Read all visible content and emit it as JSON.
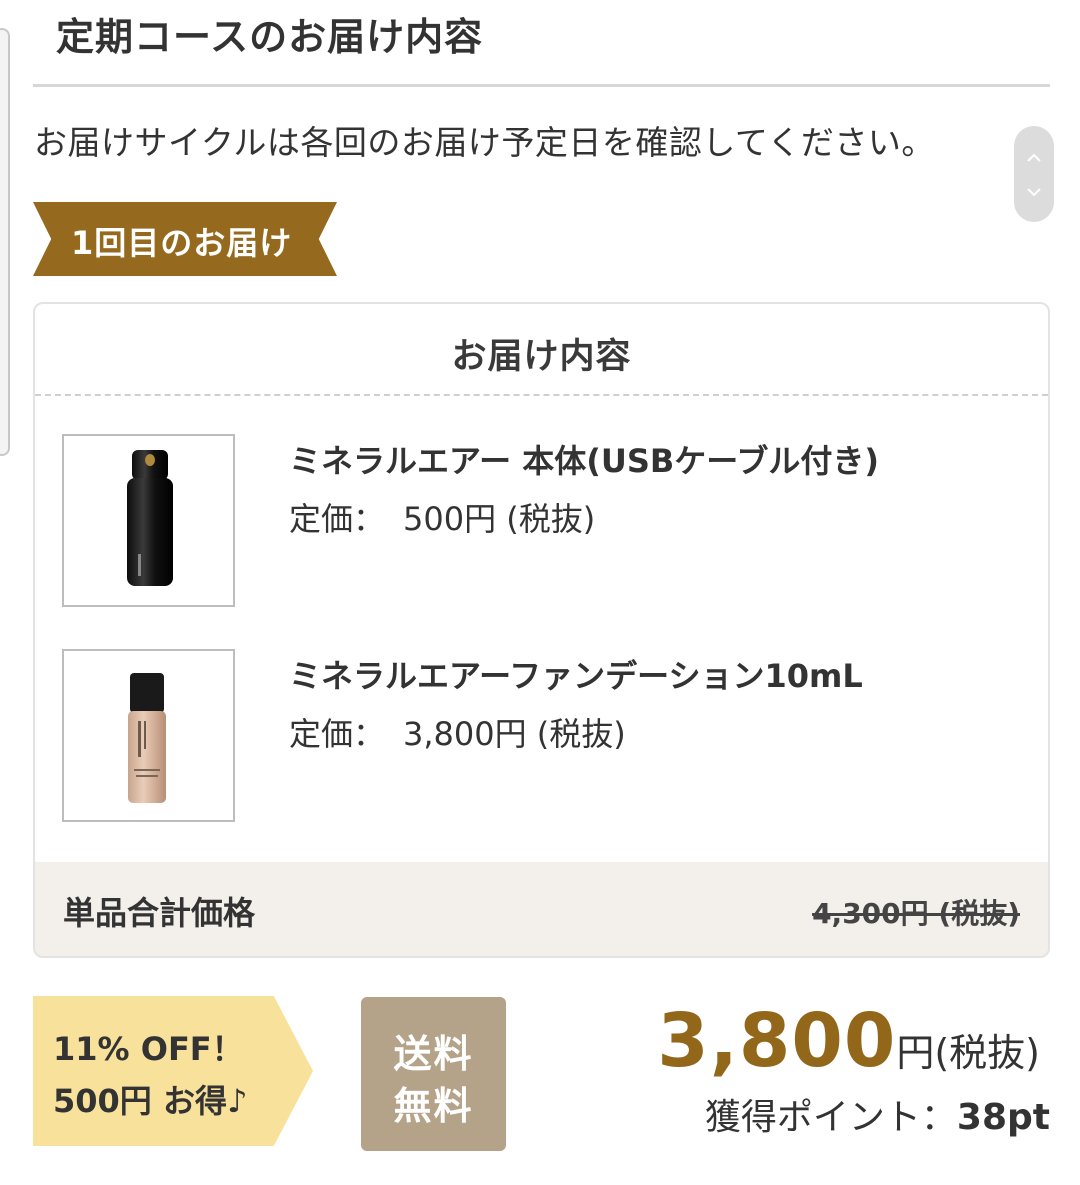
{
  "section": {
    "title": "定期コースのお届け内容",
    "notice": "お届けサイクルは各回のお届け予定日を確認してください。"
  },
  "delivery": {
    "ribbon_label": "1回目のお届け",
    "card_title": "お届け内容",
    "products": [
      {
        "name": "ミネラルエアー 本体(USBケーブル付き)",
        "price_label": "定価：",
        "price": "500円 (税抜)",
        "image": "mineral-air-device-black-bottle"
      },
      {
        "name": "ミネラルエアーファンデーション10mL",
        "price_label": "定価：",
        "price": "3,800円 (税抜)",
        "image": "foundation-bottle-beige"
      }
    ],
    "subtotal_label": "単品合計価格",
    "subtotal_original": "4,300円 (税抜)"
  },
  "offer": {
    "discount_line1": "11% OFF！",
    "discount_line2": "500円 お得♪",
    "shipping_line1": "送料",
    "shipping_line2": "無料",
    "total_value": "3,800",
    "total_unit": "円(税抜)",
    "points_label": "獲得ポイント：",
    "points_value": "38pt"
  },
  "colors": {
    "ribbon": "#966a1e",
    "discount_tag": "#f8e19a",
    "free_shipping": "#b4a389",
    "total_price": "#936719",
    "footer_bg": "#f3f0eb"
  },
  "icons": {
    "scroll_up": "chevron-up-icon",
    "scroll_down": "chevron-down-icon"
  }
}
